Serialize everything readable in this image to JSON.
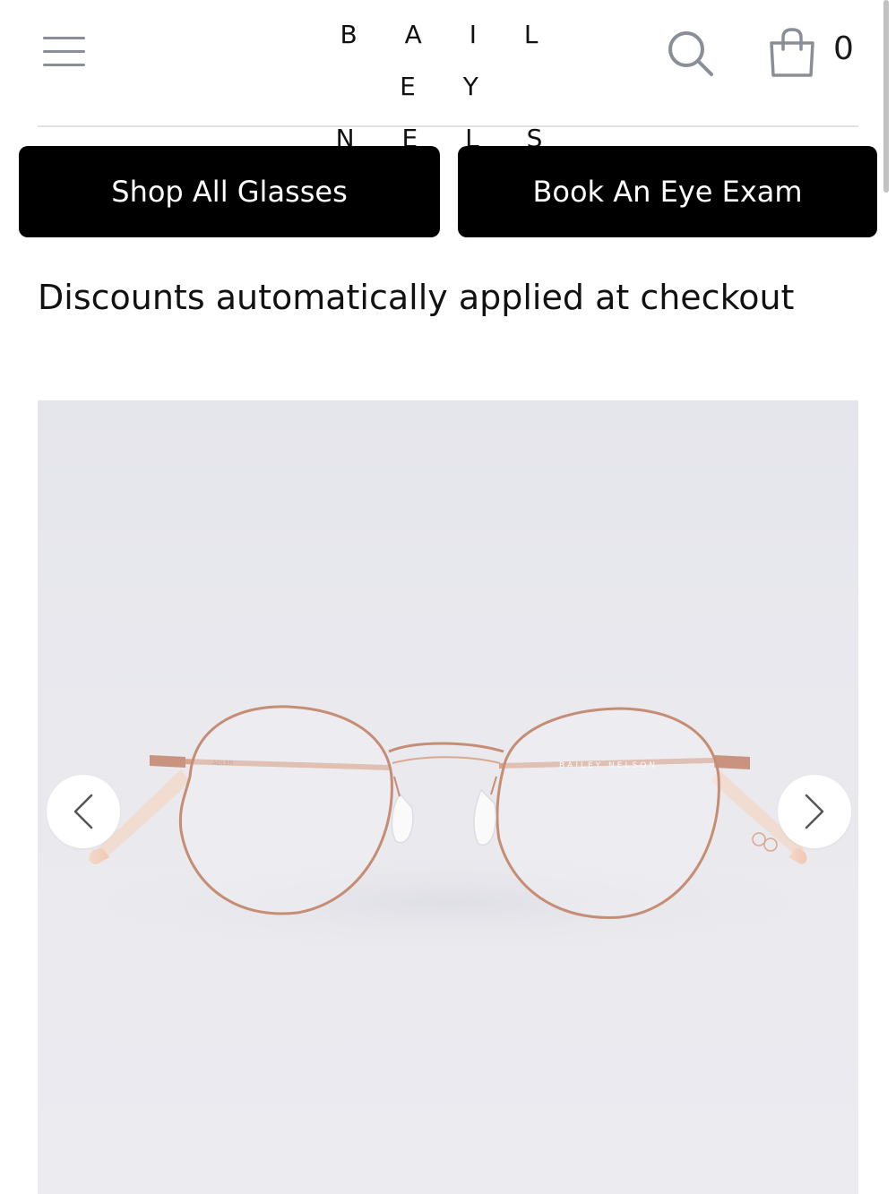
{
  "header": {
    "logo_line1": "B A I L E Y",
    "logo_line2": "N E L S O N",
    "cart_count": "0",
    "icons": {
      "menu": "hamburger-menu-icon",
      "search": "search-icon",
      "cart": "shopping-bag-icon"
    }
  },
  "actions": {
    "shop_all": "Shop All Glasses",
    "book_exam": "Book An Eye Exam"
  },
  "promo_text": "Discounts automatically applied at checkout",
  "product_image": {
    "temple_print_left": "ADLER",
    "temple_print_right": "BAILEY NELSON",
    "prev_icon": "chevron-left-icon",
    "next_icon": "chevron-right-icon"
  },
  "colors": {
    "brand_black": "#000000",
    "frame_rose_gold": "#c9937f",
    "background": "#ffffff"
  }
}
